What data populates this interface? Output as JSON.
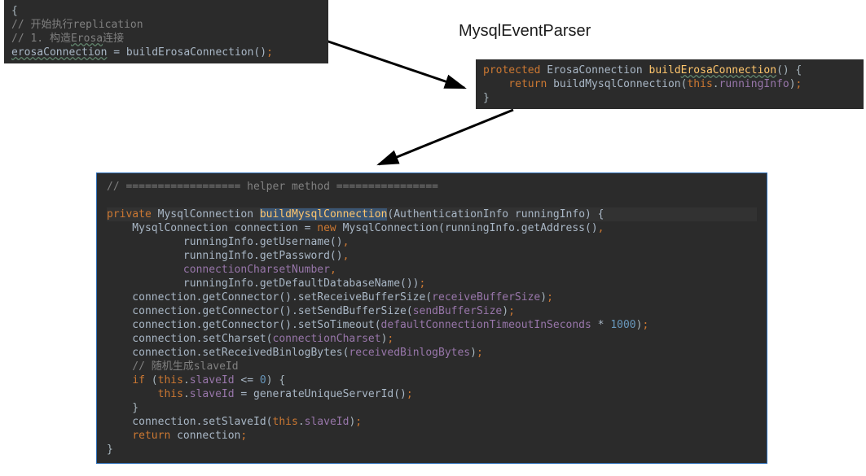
{
  "title": "MysqlEventParser",
  "box1": {
    "l1_open": "{",
    "l2_comment": "// 开始执行replication",
    "l3_comment_a": "// 1. 构造",
    "l3_comment_b": "Erosa",
    "l3_comment_c": "连接",
    "l4_a": "erosaConnection",
    "l4_b": " = buildErosaConnection()",
    "l4_semi": ";"
  },
  "box2": {
    "l1_kw": "protected",
    "l1_type": " ErosaConnection ",
    "l1_fn_a": "build",
    "l1_fn_b": "ErosaConnection",
    "l1_tail": "() {",
    "l2_ret": "    return ",
    "l2_fn": "buildMysqlConnection",
    "l2_mid": "(",
    "l2_this": "this",
    "l2_dot": ".",
    "l2_field": "runningInfo",
    "l2_end": ")",
    "l2_semi": ";",
    "l3_close": "}"
  },
  "box3": {
    "l1": "// ================== helper method ================",
    "blank1": "",
    "l3_kw": "private",
    "l3_rest_a": " MysqlConnection ",
    "l3_fn": "buildMysqlConnection",
    "l3_rest_b": "(AuthenticationInfo runningInfo) {",
    "l4_a": "    MysqlConnection connection = ",
    "l4_new": "new",
    "l4_b": " MysqlConnection(runningInfo.getAddress()",
    "l4_comma": ",",
    "l5_a": "            runningInfo.getUsername()",
    "l5_comma": ",",
    "l6_a": "            runningInfo.getPassword()",
    "l6_comma": ",",
    "l7_a": "            ",
    "l7_field": "connectionCharsetNumber",
    "l7_comma": ",",
    "l8_a": "            runningInfo.getDefaultDatabaseName())",
    "l8_semi": ";",
    "l9_a": "    connection.getConnector().setReceiveBufferSize(",
    "l9_field": "receiveBufferSize",
    "l9_end": ")",
    "l9_semi": ";",
    "l10_a": "    connection.getConnector().setSendBufferSize(",
    "l10_field": "sendBufferSize",
    "l10_end": ")",
    "l10_semi": ";",
    "l11_a": "    connection.getConnector().setSoTimeout(",
    "l11_field": "defaultConnectionTimeoutInSeconds",
    "l11_b": " * ",
    "l11_num": "1000",
    "l11_end": ")",
    "l11_semi": ";",
    "l12_a": "    connection.setCharset(",
    "l12_field": "connectionCharset",
    "l12_end": ")",
    "l12_semi": ";",
    "l13_a": "    connection.setReceivedBinlogBytes(",
    "l13_field": "receivedBinlogBytes",
    "l13_end": ")",
    "l13_semi": ";",
    "l14_comment": "    // 随机生成slaveId",
    "l15_a": "    ",
    "l15_if": "if",
    "l15_b": " (",
    "l15_this": "this",
    "l15_c": ".",
    "l15_field": "slaveId",
    "l15_d": " <= ",
    "l15_num": "0",
    "l15_e": ") {",
    "l16_a": "        ",
    "l16_this": "this",
    "l16_b": ".",
    "l16_field": "slaveId",
    "l16_c": " = generateUniqueServerId()",
    "l16_semi": ";",
    "l17_close": "    }",
    "l18_a": "    connection.setSlaveId(",
    "l18_this": "this",
    "l18_b": ".",
    "l18_field": "slaveId",
    "l18_end": ")",
    "l18_semi": ";",
    "l19_a": "    ",
    "l19_ret": "return",
    "l19_b": " connection",
    "l19_semi": ";",
    "l20_close": "}"
  }
}
